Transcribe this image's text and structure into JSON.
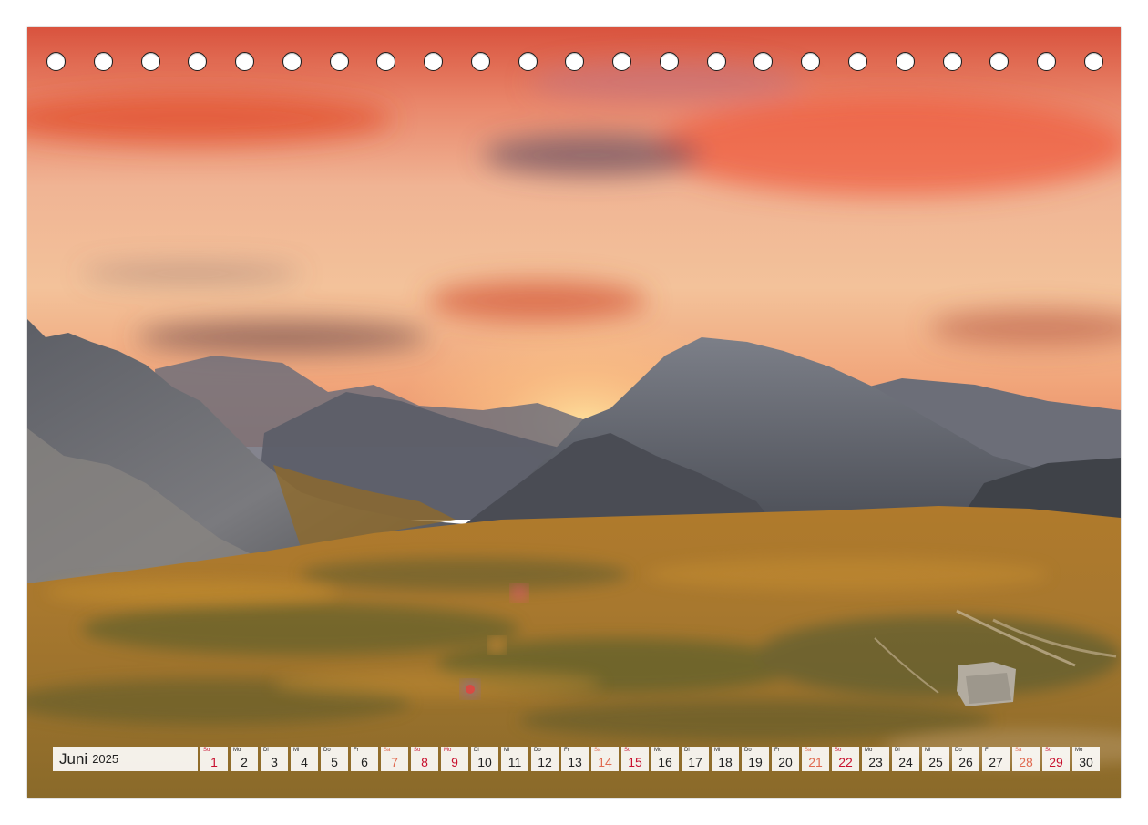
{
  "photo": {
    "subject": "mountain-landscape-sunset-photo"
  },
  "binding": {
    "hole_count": 23
  },
  "calendar": {
    "month": "Juni",
    "year": "2025",
    "colors": {
      "saturday": "#e06a50",
      "sunday": "#c8102e",
      "weekday": "#222222"
    },
    "days": [
      {
        "wd": "So",
        "d": "1",
        "type": "sun"
      },
      {
        "wd": "Mo",
        "d": "2",
        "type": "week"
      },
      {
        "wd": "Di",
        "d": "3",
        "type": "week"
      },
      {
        "wd": "Mi",
        "d": "4",
        "type": "week"
      },
      {
        "wd": "Do",
        "d": "5",
        "type": "week"
      },
      {
        "wd": "Fr",
        "d": "6",
        "type": "week"
      },
      {
        "wd": "Sa",
        "d": "7",
        "type": "sat"
      },
      {
        "wd": "So",
        "d": "8",
        "type": "sun"
      },
      {
        "wd": "Mo",
        "d": "9",
        "type": "sun"
      },
      {
        "wd": "Di",
        "d": "10",
        "type": "week"
      },
      {
        "wd": "Mi",
        "d": "11",
        "type": "week"
      },
      {
        "wd": "Do",
        "d": "12",
        "type": "week"
      },
      {
        "wd": "Fr",
        "d": "13",
        "type": "week"
      },
      {
        "wd": "Sa",
        "d": "14",
        "type": "sat"
      },
      {
        "wd": "So",
        "d": "15",
        "type": "sun"
      },
      {
        "wd": "Mo",
        "d": "16",
        "type": "week"
      },
      {
        "wd": "Di",
        "d": "17",
        "type": "week"
      },
      {
        "wd": "Mi",
        "d": "18",
        "type": "week"
      },
      {
        "wd": "Do",
        "d": "19",
        "type": "week"
      },
      {
        "wd": "Fr",
        "d": "20",
        "type": "week"
      },
      {
        "wd": "Sa",
        "d": "21",
        "type": "sat"
      },
      {
        "wd": "So",
        "d": "22",
        "type": "sun"
      },
      {
        "wd": "Mo",
        "d": "23",
        "type": "week"
      },
      {
        "wd": "Di",
        "d": "24",
        "type": "week"
      },
      {
        "wd": "Mi",
        "d": "25",
        "type": "week"
      },
      {
        "wd": "Do",
        "d": "26",
        "type": "week"
      },
      {
        "wd": "Fr",
        "d": "27",
        "type": "week"
      },
      {
        "wd": "Sa",
        "d": "28",
        "type": "sat"
      },
      {
        "wd": "So",
        "d": "29",
        "type": "sun"
      },
      {
        "wd": "Mo",
        "d": "30",
        "type": "week"
      }
    ]
  }
}
